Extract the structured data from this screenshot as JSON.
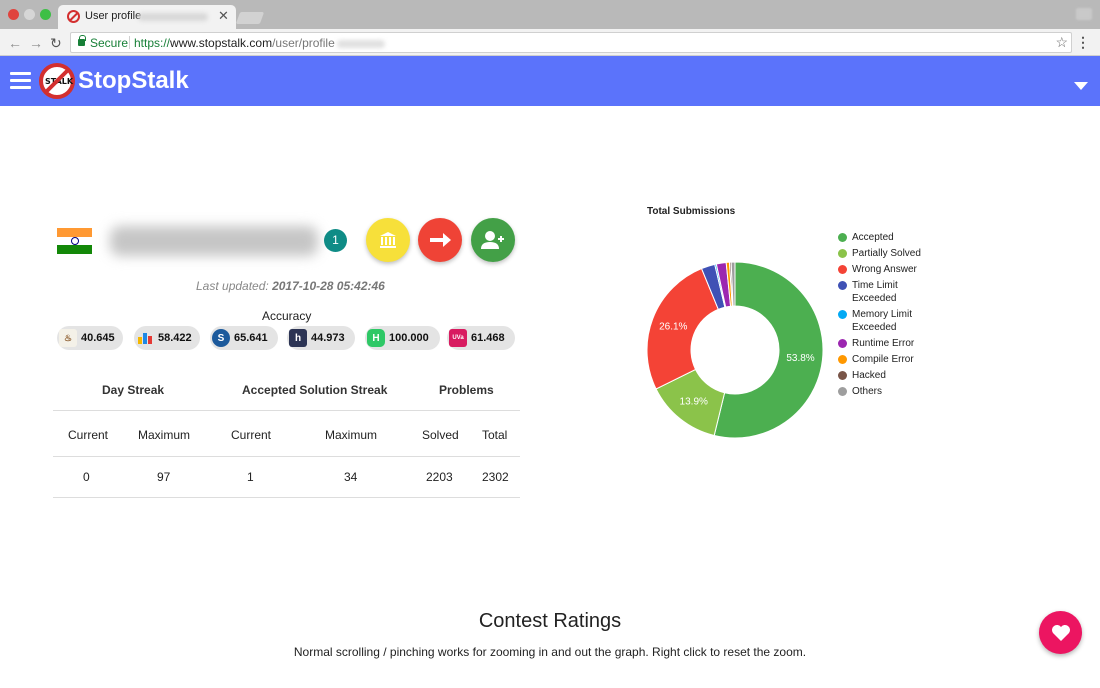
{
  "browser": {
    "tab_title": "User profile",
    "secure_label": "Secure",
    "url_scheme": "https://",
    "url_host": "www.stopstalk.com",
    "url_path": "/user/profile"
  },
  "header": {
    "brand": "StopStalk",
    "logo_text": "STALK",
    "brand_color": "#5b73fb"
  },
  "profile": {
    "rank": "1",
    "last_updated_label": "Last updated:",
    "last_updated_value": "2017-10-28 05:42:46",
    "accuracy_title": "Accuracy",
    "accuracy_chips": [
      {
        "site": "codechef",
        "value": "40.645"
      },
      {
        "site": "codeforces",
        "value": "58.422"
      },
      {
        "site": "spoj",
        "value": "65.641"
      },
      {
        "site": "hackerearth",
        "value": "44.973"
      },
      {
        "site": "hackerrank",
        "value": "100.000"
      },
      {
        "site": "uva",
        "value": "61.468"
      }
    ]
  },
  "streaks": {
    "headers": {
      "day_streak": "Day Streak",
      "accepted_streak": "Accepted Solution Streak",
      "problems": "Problems"
    },
    "subheaders": {
      "current1": "Current",
      "max1": "Maximum",
      "current2": "Current",
      "max2": "Maximum",
      "solved": "Solved",
      "total": "Total"
    },
    "values": {
      "day_current": "0",
      "day_max": "97",
      "acc_current": "1",
      "acc_max": "34",
      "solved": "2203",
      "total": "2302"
    }
  },
  "chart_data": {
    "type": "pie",
    "title": "Total Submissions",
    "donut": true,
    "legend": "right",
    "labels": [
      "Accepted",
      "Partially Solved",
      "Wrong Answer",
      "Time Limit Exceeded",
      "Memory Limit Exceeded",
      "Runtime Error",
      "Compile Error",
      "Hacked",
      "Others"
    ],
    "values": [
      53.8,
      13.9,
      26.1,
      2.5,
      0.3,
      1.8,
      0.6,
      0.3,
      0.7
    ],
    "shown_labels": [
      "53.8%",
      "13.9%",
      "26.1%",
      null,
      null,
      null,
      null,
      null,
      null
    ],
    "colors": [
      "#4caf50",
      "#8bc34a",
      "#f44336",
      "#3f51b5",
      "#03a9f4",
      "#9c27b0",
      "#ff9800",
      "#795548",
      "#9e9e9e"
    ]
  },
  "contest": {
    "title": "Contest Ratings",
    "note": "Normal scrolling / pinching works for zooming in and out the graph. Right click to reset the zoom."
  },
  "icons": {
    "fab1": "institution-icon",
    "fab2": "arrow-right-icon",
    "fab3": "add-friend-icon",
    "fab4": "heart-icon"
  }
}
